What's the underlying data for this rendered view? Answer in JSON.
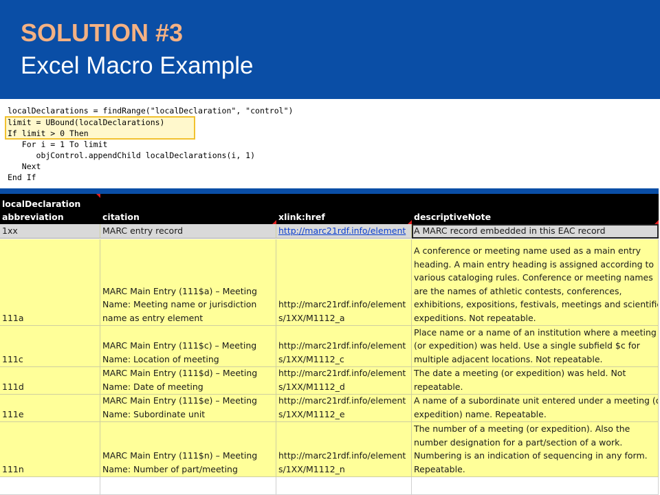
{
  "slide": {
    "title": "SOLUTION #3",
    "subtitle": "Excel Macro Example"
  },
  "code": {
    "lines": [
      "localDeclarations = findRange(\"localDeclaration\", \"control\")",
      "limit = UBound(localDeclarations)",
      "If limit > 0 Then",
      "   For i = 1 To limit",
      "      objControl.appendChild localDeclarations(i, 1)",
      "   Next",
      "End If"
    ]
  },
  "sheet": {
    "columns": [
      {
        "label": "localDeclaration\nabbreviation"
      },
      {
        "label": "citation"
      },
      {
        "label": "xlink:href"
      },
      {
        "label": "descriptiveNote"
      }
    ],
    "rows": [
      {
        "abbreviation": "1xx",
        "citation": "MARC entry record",
        "href": "http://marc21rdf.info/element",
        "note": "A MARC record embedded in this EAC record"
      },
      {
        "abbreviation": "111a",
        "citation": "MARC Main Entry (111$a) – Meeting\nName: Meeting name or jurisdiction\nname as entry element",
        "href": "http://marc21rdf.info/element\ns/1XX/M1112_a",
        "note": "A conference or meeting name used as a main entry\nheading. A main entry heading is assigned according to\nvarious cataloging rules. Conference or meeting names\nare the names of athletic contests, conferences,\nexhibitions, expositions, festivals, meetings and scientific\nexpeditions. Not repeatable."
      },
      {
        "abbreviation": "111c",
        "citation": "MARC Main Entry (111$c) – Meeting\nName: Location of meeting",
        "href": "http://marc21rdf.info/element\ns/1XX/M1112_c",
        "note": "Place name or a name of an institution where a meeting\n(or expedition) was held. Use a single subfield $c for\nmultiple adjacent locations. Not repeatable."
      },
      {
        "abbreviation": "111d",
        "citation": "MARC Main Entry (111$d) – Meeting\nName: Date of meeting",
        "href": "http://marc21rdf.info/element\ns/1XX/M1112_d",
        "note": "The date a meeting (or expedition) was held. Not\nrepeatable."
      },
      {
        "abbreviation": "111e",
        "citation": "MARC Main Entry (111$e) – Meeting\nName: Subordinate unit",
        "href": "http://marc21rdf.info/element\ns/1XX/M1112_e",
        "note": "A name of a subordinate unit entered under a meeting (or\nexpedition) name. Repeatable."
      },
      {
        "abbreviation": "111n",
        "citation": "MARC Main Entry (111$n) – Meeting\nName: Number of part/meeting",
        "href": "http://marc21rdf.info/element\ns/1XX/M1112_n",
        "note": "The number of a meeting (or expedition). Also the\nnumber designation for a part/section of a work.\nNumbering is an indication of sequencing in any form.\nRepeatable."
      }
    ]
  },
  "colors": {
    "header_blue": "#0a4ea6",
    "title_orange": "#f4b183",
    "cell_yellow": "#ffff99",
    "code_highlight": "#f2c12e"
  }
}
